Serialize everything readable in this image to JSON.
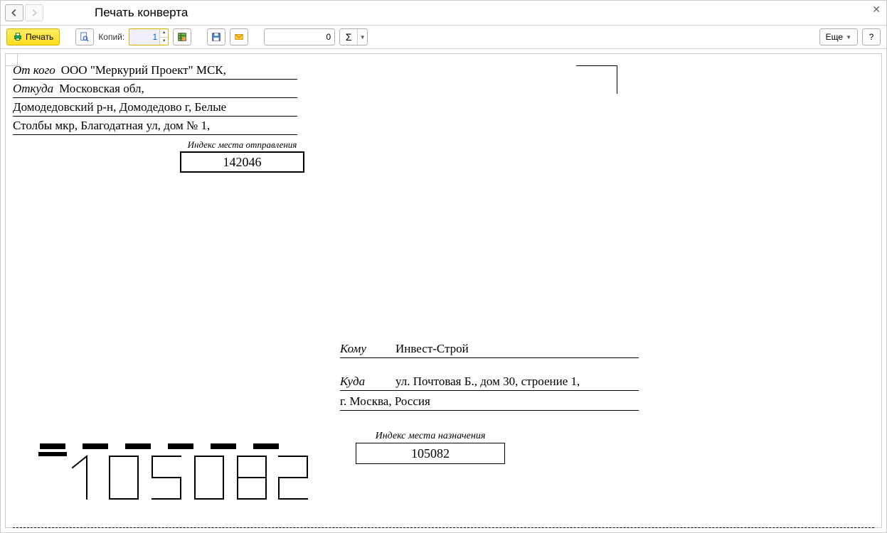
{
  "window": {
    "title": "Печать конверта"
  },
  "toolbar": {
    "print_label": "Печать",
    "copies_label": "Копий:",
    "copies_value": "1",
    "num_value": "0",
    "more_label": "Еще",
    "help_label": "?"
  },
  "envelope": {
    "sender": {
      "from_label": "От кого",
      "from_value": "ООО \"Меркурий Проект\" МСК,",
      "where_label": "Откуда",
      "where_value": "Московская обл,",
      "addr_line2": "Домодедовский р-н, Домодедово г, Белые",
      "addr_line3": "Столбы мкр, Благодатная ул, дом № 1,",
      "index_caption": "Индекс места отправления",
      "index_value": "142046"
    },
    "recipient": {
      "to_label": "Кому",
      "to_value": "Инвест-Строй",
      "where_label": "Куда",
      "where_value": "ул. Почтовая Б., дом 30, строение 1,",
      "addr_line2": "г. Москва, Россия",
      "index_caption": "Индекс места назначения",
      "index_value": "105082"
    },
    "big_zip": "105082"
  }
}
